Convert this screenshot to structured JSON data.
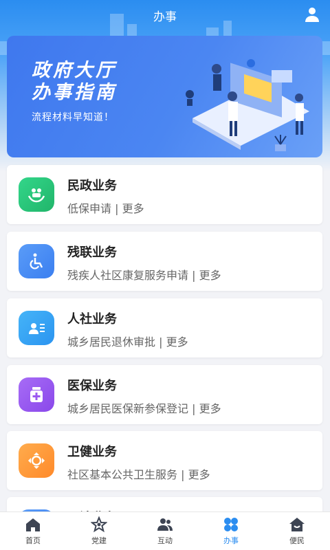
{
  "topbar": {
    "title": "办事"
  },
  "banner": {
    "title_line1": "政府大厅",
    "title_line2": "办事指南",
    "subtitle": "流程材料早知道！"
  },
  "cards": [
    {
      "title": "民政业务",
      "subtitle": "低保申请 | 更多",
      "icon": "family-hands-icon",
      "color": "#2dcb7c"
    },
    {
      "title": "残联业务",
      "subtitle": "残疾人社区康复服务申请 | 更多",
      "icon": "wheelchair-icon",
      "color": "#4a8ff5"
    },
    {
      "title": "人社业务",
      "subtitle": "城乡居民退休审批 | 更多",
      "icon": "id-card-icon",
      "color": "#36a6f5"
    },
    {
      "title": "医保业务",
      "subtitle": "城乡居民医保新参保登记 | 更多",
      "icon": "medicine-bottle-icon",
      "color": "#9b59f0"
    },
    {
      "title": "卫健业务",
      "subtitle": "社区基本公共卫生服务 | 更多",
      "icon": "health-cross-icon",
      "color": "#ff9a3c"
    },
    {
      "title": "司法业务",
      "subtitle": "",
      "icon": "scale-icon",
      "color": "#4a8ff5"
    }
  ],
  "tabbar": [
    {
      "label": "首页",
      "icon": "home-icon",
      "active": false
    },
    {
      "label": "党建",
      "icon": "party-star-icon",
      "active": false
    },
    {
      "label": "互动",
      "icon": "people-icon",
      "active": false
    },
    {
      "label": "办事",
      "icon": "grid-flower-icon",
      "active": true
    },
    {
      "label": "便民",
      "icon": "house-smile-icon",
      "active": false
    }
  ]
}
